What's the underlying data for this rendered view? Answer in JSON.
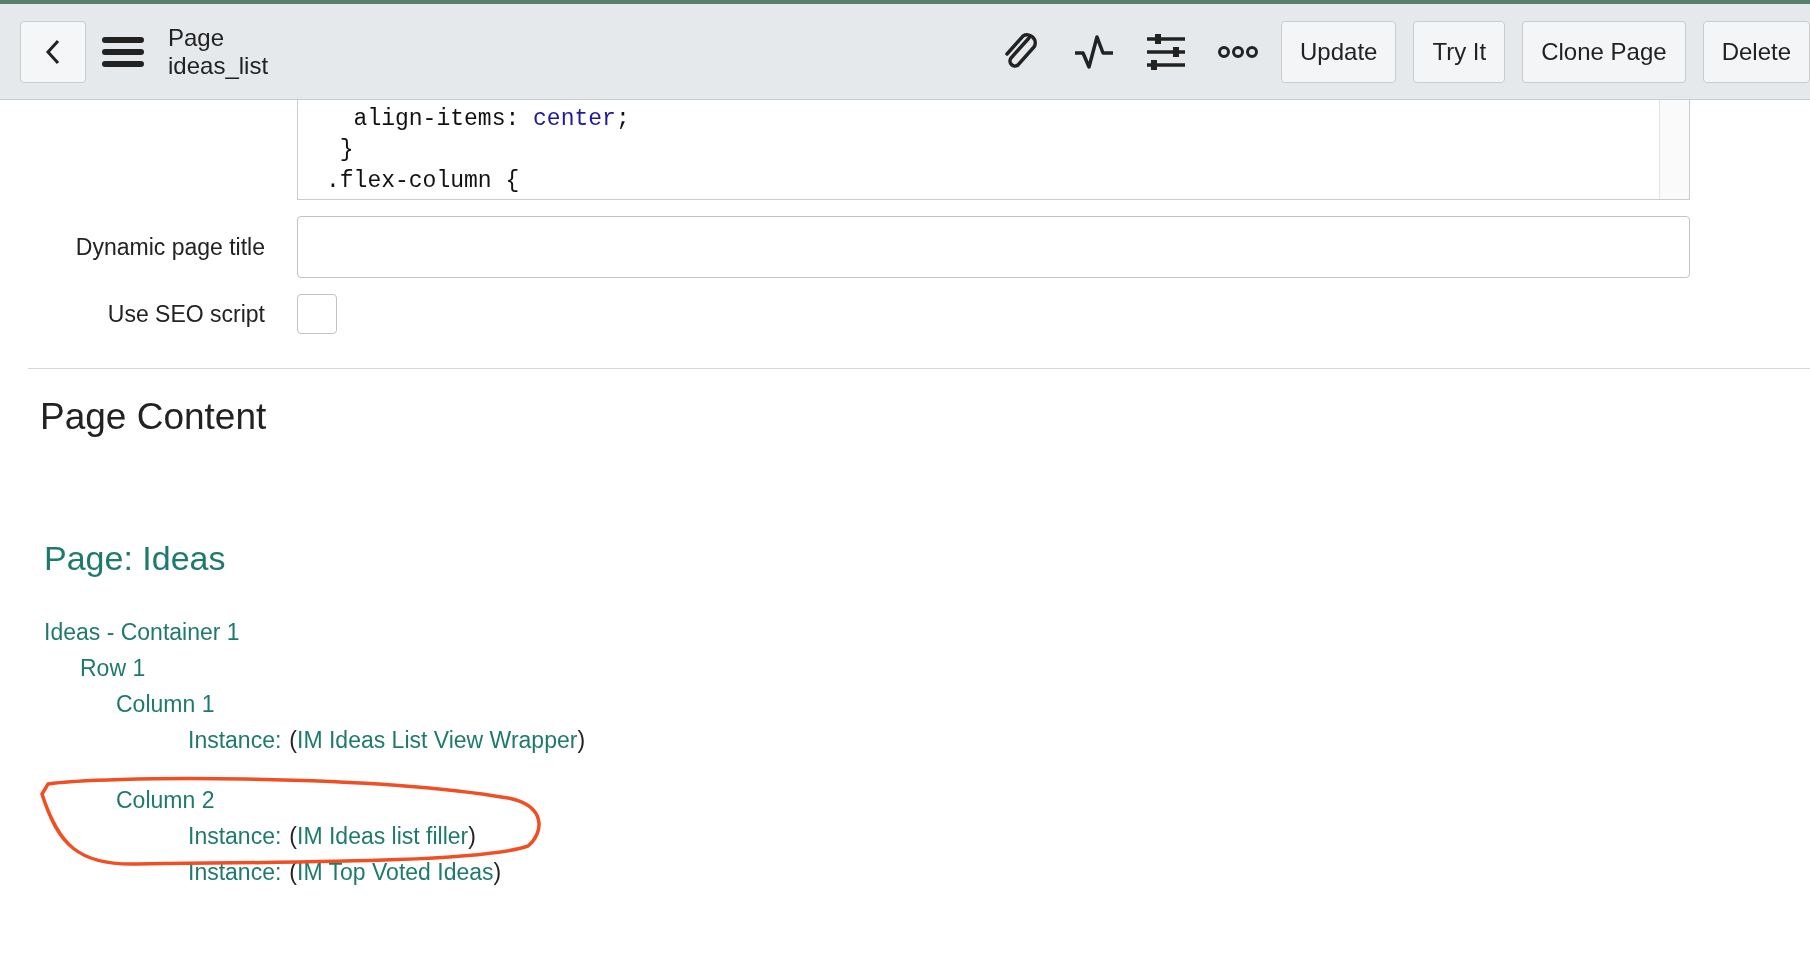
{
  "header": {
    "title": "Page",
    "subtitle": "ideas_list",
    "buttons": [
      "Update",
      "Try It",
      "Clone Page",
      "Delete"
    ]
  },
  "form": {
    "code_lines": [
      [
        {
          "kind": "plain",
          "text": "  align-items: "
        },
        {
          "kind": "value",
          "text": "center"
        },
        {
          "kind": "plain",
          "text": ";"
        }
      ],
      [
        {
          "kind": "plain",
          "text": " }"
        }
      ],
      [
        {
          "kind": "plain",
          "text": ".flex-column {"
        }
      ]
    ],
    "fields": [
      {
        "kind": "text",
        "label": "Dynamic page title"
      },
      {
        "kind": "checkbox",
        "label": "Use SEO script",
        "checked": false
      }
    ]
  },
  "page_content": {
    "heading": "Page Content",
    "page_title": "Page: Ideas",
    "tree": [
      {
        "label": "Ideas - Container 1",
        "children": [
          {
            "label": "Row 1",
            "children": [
              {
                "label": "Column 1",
                "children": [
                  {
                    "kind": "instance",
                    "label": "Instance:",
                    "open": "(",
                    "link": "IM Ideas List View Wrapper",
                    "close": ")"
                  }
                ]
              },
              {
                "label": "Column 2",
                "children": [
                  {
                    "kind": "instance",
                    "label": "Instance:",
                    "open": "(",
                    "link": "IM Ideas list filler",
                    "close": ")"
                  },
                  {
                    "kind": "instance",
                    "label": "Instance:",
                    "open": "(",
                    "link": "IM Top Voted Ideas",
                    "close": ")"
                  }
                ]
              }
            ]
          }
        ]
      }
    ]
  },
  "annotations": [
    {
      "kind": "loop",
      "color": "#f04e23"
    }
  ]
}
